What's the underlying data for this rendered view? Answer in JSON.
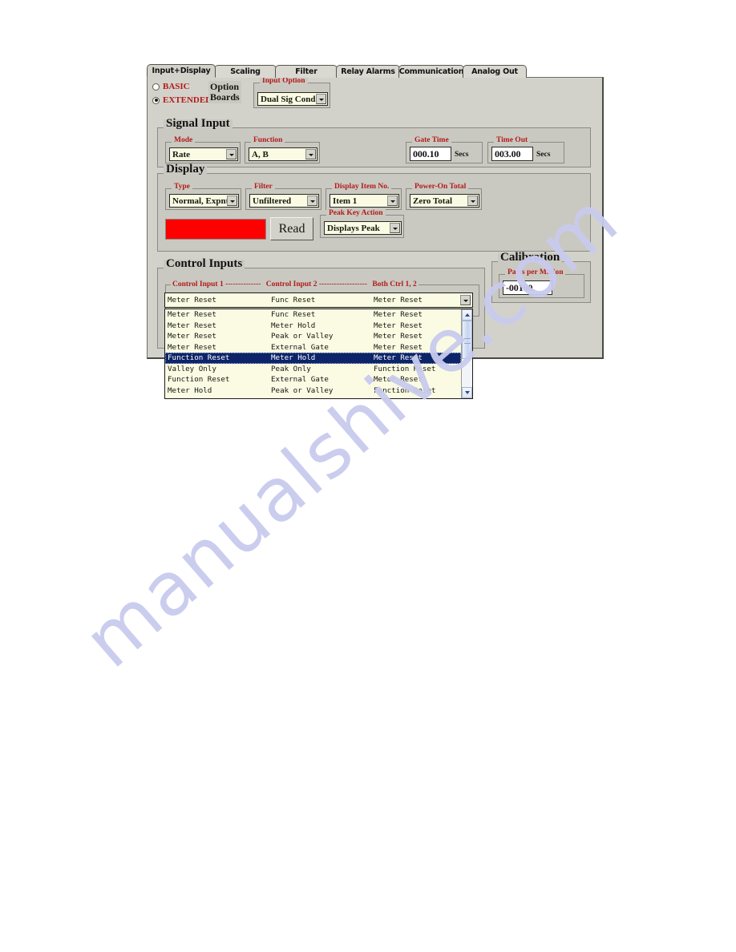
{
  "tabs": [
    {
      "label": "Input+Display",
      "active": true
    },
    {
      "label": "Scaling",
      "active": false
    },
    {
      "label": "Filter",
      "active": false
    },
    {
      "label": "Relay Alarms",
      "active": false
    },
    {
      "label": "Communication",
      "active": false
    },
    {
      "label": "Analog Out",
      "active": false
    }
  ],
  "option_boards": {
    "label_line1": "Option",
    "label_line2": "Boards",
    "radio_basic": "BASIC",
    "radio_extended": "EXTENDED",
    "selected": "EXTENDED",
    "input_option_title": "Input Option",
    "input_option_value": "Dual Sig Cond"
  },
  "signal_input": {
    "title": "Signal Input",
    "mode_title": "Mode",
    "mode_value": "Rate",
    "function_title": "Function",
    "function_value": "A, B",
    "gate_time_title": "Gate Time",
    "gate_time_value": "000.10",
    "gate_time_unit": "Secs",
    "time_out_title": "Time Out",
    "time_out_value": "003.00",
    "time_out_unit": "Secs"
  },
  "display": {
    "title": "Display",
    "type_title": "Type",
    "type_value": "Normal, Expnt",
    "filter_title": "Filter",
    "filter_value": "Unfiltered",
    "item_no_title": "Display Item No.",
    "item_no_value": "Item 1",
    "power_on_total_title": "Power-On Total",
    "power_on_total_value": "Zero Total",
    "read_button": "Read",
    "readout_color": "#fe0000",
    "readout_value": "",
    "peak_key_title": "Peak Key Action",
    "peak_key_value": "Displays Peak"
  },
  "control_inputs": {
    "title": "Control Inputs",
    "header": "Control Input 1 -------------- Control Input 2 ------------------- Both Ctrl 1, 2",
    "header_c1": "Control Input 1 --------------",
    "header_c2": "Control Input 2 -------------------",
    "header_c3": "Both Ctrl 1, 2",
    "selected_row": {
      "c1": "Meter Reset",
      "c2": "Func Reset",
      "c3": "Meter Reset"
    },
    "options": [
      {
        "c1": "Meter Reset",
        "c2": "Func Reset",
        "c3": "Meter Reset",
        "highlighted": false
      },
      {
        "c1": "Meter Reset",
        "c2": "Meter Hold",
        "c3": "Meter Reset",
        "highlighted": false
      },
      {
        "c1": "Meter Reset",
        "c2": "Peak or Valley",
        "c3": "Meter Reset",
        "highlighted": false
      },
      {
        "c1": "Meter Reset",
        "c2": "External Gate",
        "c3": "Meter Reset",
        "highlighted": false
      },
      {
        "c1": "Function Reset",
        "c2": "Meter Hold",
        "c3": "Meter Reset",
        "highlighted": true
      },
      {
        "c1": "Valley Only",
        "c2": "Peak Only",
        "c3": "Function Reset",
        "highlighted": false
      },
      {
        "c1": "Function Reset",
        "c2": "External Gate",
        "c3": "Meter Reset",
        "highlighted": false
      },
      {
        "c1": "Meter Hold",
        "c2": "Peak or Valley",
        "c3": "Function Reset",
        "highlighted": false
      }
    ]
  },
  "calibration": {
    "title": "Calibration",
    "ppm_title": "Parts per Million",
    "ppm_value": "-00100."
  },
  "watermark": {
    "text": "manualshive.com"
  }
}
